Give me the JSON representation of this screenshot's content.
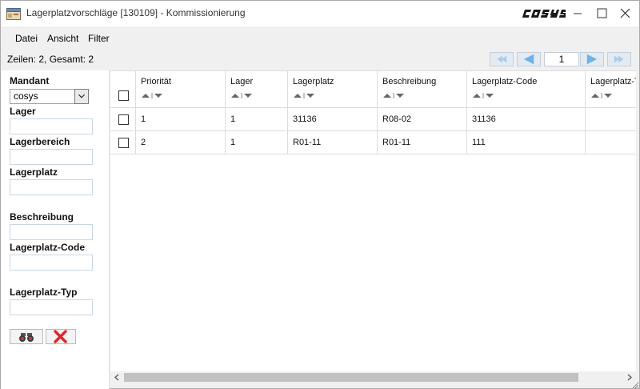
{
  "window": {
    "title": "Lagerplatzvorschläge [130109] - Kommissionierung",
    "brand": "cosys"
  },
  "menu": [
    "Datei",
    "Ansicht",
    "Filter"
  ],
  "status": {
    "rows_text": "Zeilen: 2, Gesamt: 2",
    "page": "1"
  },
  "filters": {
    "mandant_label": "Mandant",
    "mandant_value": "cosys",
    "lager_label": "Lager",
    "lagerbereich_label": "Lagerbereich",
    "lagerplatz_label": "Lagerplatz",
    "beschreibung_label": "Beschreibung",
    "lagerplatz_code_label": "Lagerplatz-Code",
    "lagerplatz_typ_label": "Lagerplatz-Typ"
  },
  "table": {
    "columns": [
      "Priorität",
      "Lager",
      "Lagerplatz",
      "Beschreibung",
      "Lagerplatz-Code",
      "Lagerplatz-T"
    ],
    "rows": [
      [
        "1",
        "1",
        "31136",
        "R08-02",
        "31136",
        ""
      ],
      [
        "2",
        "1",
        "R01-11",
        "R01-11",
        "111",
        ""
      ]
    ]
  },
  "colors": {
    "accent_blue": "#6fb1e8",
    "delete_red": "#e0242a",
    "brand_dark": "#1a1a1a"
  },
  "icons": {
    "app": "window-app-icon",
    "search": "binoculars-icon",
    "reset": "red-x-icon"
  }
}
